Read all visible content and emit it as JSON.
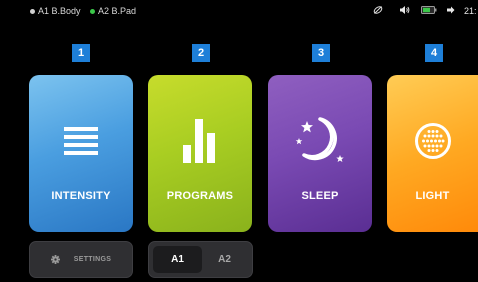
{
  "status_bar": {
    "devices": [
      {
        "label": "A1 B.Body",
        "dot_color": "#d0d0d0"
      },
      {
        "label": "A2 B.Pad",
        "dot_color": "#3cc84a"
      }
    ],
    "icons": [
      "no-signal-icon",
      "volume-icon",
      "battery-icon",
      "bluetooth-icon"
    ],
    "time": "21:"
  },
  "modes": [
    {
      "number": "1",
      "label": "INTENSITY",
      "icon": "intensity-lines-icon"
    },
    {
      "number": "2",
      "label": "PROGRAMS",
      "icon": "bars-chart-icon"
    },
    {
      "number": "3",
      "label": "SLEEP",
      "icon": "moon-stars-icon"
    },
    {
      "number": "4",
      "label": "LIGHT",
      "icon": "light-dots-icon"
    }
  ],
  "bottom": {
    "settings_label": "SETTINGS",
    "settings_icon": "gear-icon",
    "zone_options": [
      "A1",
      "A2"
    ],
    "zone_selected": "A1"
  },
  "colors": {
    "badge": "#1e7fd8",
    "intensity": "#4a9ee0",
    "programs": "#a8cd22",
    "sleep": "#7a4ab3",
    "light": "#ffa922"
  }
}
